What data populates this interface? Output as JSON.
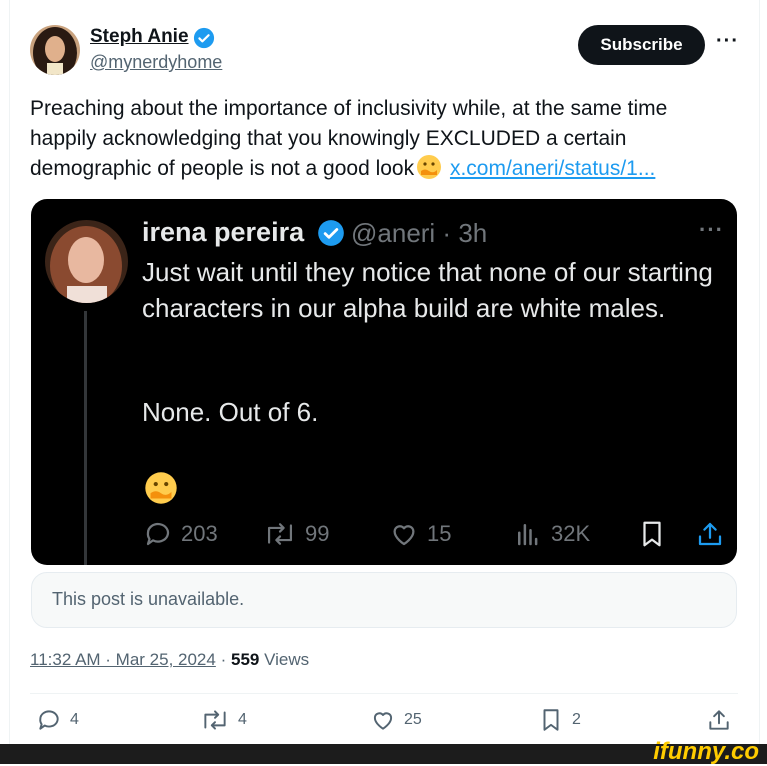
{
  "author": {
    "name": "Steph Anie",
    "handle": "@mynerdyhome",
    "subscribe_label": "Subscribe",
    "more_label": "···"
  },
  "post": {
    "text": "Preaching about the importance of inclusivity while, at the same time happily acknowledging that you knowingly EXCLUDED a certain demographic of people is not a good look",
    "link": "x.com/aneri/status/1..."
  },
  "embed": {
    "name": "irena pereira",
    "handle": "@aneri · 3h",
    "more_label": "···",
    "text": "Just wait until they notice that none of our starting characters in our alpha build are white males.",
    "text2": "None. Out of 6.",
    "stats": {
      "replies": "203",
      "reposts": "99",
      "likes": "15",
      "views": "32K"
    }
  },
  "unavailable": "This post is unavailable.",
  "meta": {
    "time_date": "11:32 AM · Mar 25, 2024",
    "separator": "·",
    "views_count": "559",
    "views_label": "Views"
  },
  "actions": {
    "replies": "4",
    "reposts": "4",
    "likes": "25",
    "bookmarks": "2"
  },
  "watermark": "ifunny.co",
  "colors": {
    "link": "#1d9bf0",
    "verified": "#1d9bf0",
    "watermark": "#ffcc00"
  }
}
